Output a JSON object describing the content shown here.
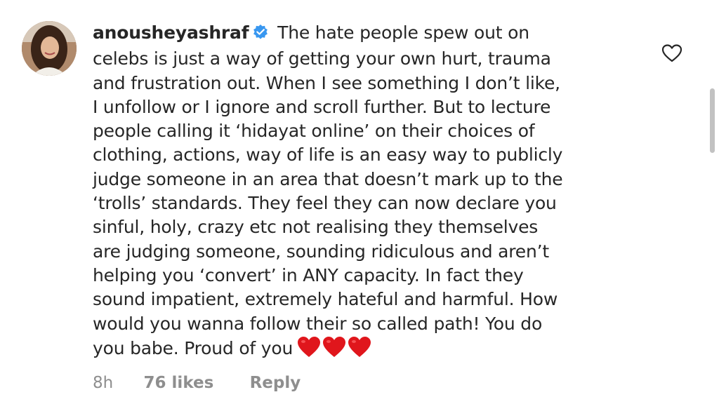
{
  "comment": {
    "username": "anousheyashraf",
    "verified": true,
    "text": " The hate people spew out on\ncelebs is just a way of getting your own hurt, trauma\nand frustration out. When I see something I don’t like,\nI unfollow or I ignore and scroll further. But to lecture\npeople calling it ‘hidayat online’ on their choices of\nclothing, actions, way of life is an easy way to publicly\njudge someone in an area that doesn’t mark up to the\n‘trolls’ standards. They feel they can now declare you\nsinful, holy, crazy etc not realising they themselves\nare judging someone, sounding ridiculous and aren’t\nhelping you ‘convert’ in ANY capacity. In fact they\nsound impatient, extremely hateful and harmful. How\nwould you wanna follow their so called path! You do\nyou babe. Proud of you",
    "emoji": "❤️❤️❤️",
    "time": "8h",
    "likes": "76 likes",
    "reply_label": "Reply"
  },
  "icons": {
    "verified": "verified-badge-icon",
    "like": "heart-outline-icon",
    "emoji": "red-heart-icon"
  },
  "colors": {
    "text": "#262626",
    "meta": "#8e8e8e",
    "verified": "#3897f0",
    "heart": "#e0161c"
  }
}
